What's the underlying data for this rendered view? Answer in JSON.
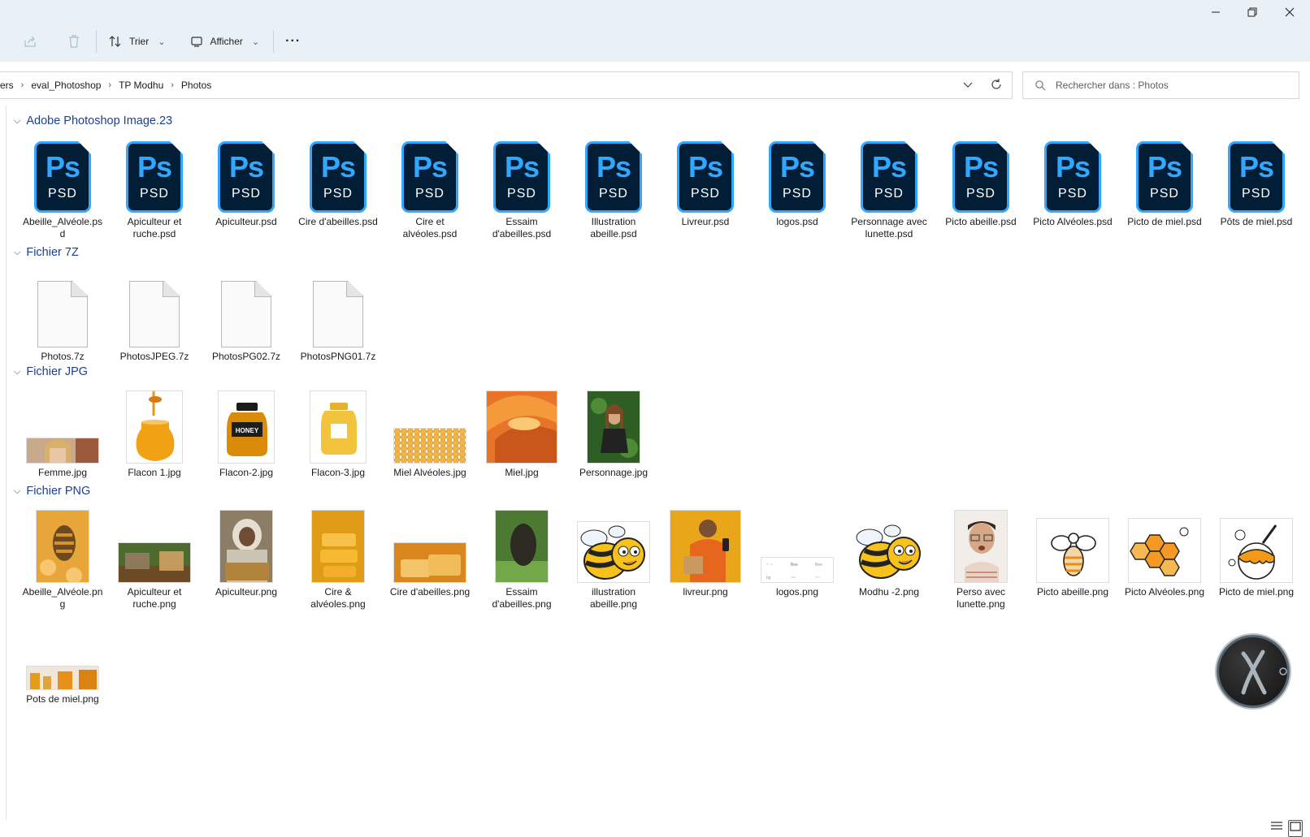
{
  "toolbar": {
    "sort_label": "Trier",
    "view_label": "Afficher",
    "more_label": "···"
  },
  "address": {
    "crumbs": [
      "ers",
      "eval_Photoshop",
      "TP Modhu",
      "Photos"
    ]
  },
  "search": {
    "placeholder": "Rechercher dans : Photos"
  },
  "groups": {
    "psd": {
      "title": "Adobe Photoshop Image.23",
      "icon_main": "Ps",
      "icon_sub": "PSD",
      "items": [
        "Abeille_Alvéole.psd",
        "Apiculteur et ruche.psd",
        "Apiculteur.psd",
        "Cire d'abeilles.psd",
        "Cire et alvéoles.psd",
        "Essaim d'abeilles.psd",
        "Illustration abeille.psd",
        "Livreur.psd",
        "logos.psd",
        "Personnage avec lunette.psd",
        "Picto abeille.psd",
        "Picto Alvéoles.psd",
        "Picto de miel.psd",
        "Pôts de miel.psd"
      ]
    },
    "sevenz": {
      "title": "Fichier 7Z",
      "items": [
        "Photos.7z",
        "PhotosJPEG.7z",
        "PhotosPG02.7z",
        "PhotosPNG01.7z"
      ]
    },
    "jpg": {
      "title": "Fichier JPG",
      "items": [
        "Femme.jpg",
        "Flacon 1.jpg",
        "Flacon-2.jpg",
        "Flacon-3.jpg",
        "Miel Alvéoles.jpg",
        "Miel.jpg",
        "Personnage.jpg"
      ],
      "jar_text": "HONEY"
    },
    "png": {
      "title": "Fichier PNG",
      "items": [
        "Abeille_Alvéole.png",
        "Apiculteur et ruche.png",
        "Apiculteur.png",
        "Cire & alvéoles.png",
        "Cire d'abeilles.png",
        "Essaim d'abeilles.png",
        "illustration abeille.png",
        "livreur.png",
        "logos.png",
        "Modhu -2.png",
        "Perso avec lunette.png",
        "Picto abeille.png",
        "Picto Alvéoles.png",
        "Picto de miel.png",
        "Pots de miel.png"
      ]
    }
  },
  "colors": {
    "accent": "#1b3f97",
    "psd_blue": "#31a8ff",
    "psd_bg": "#011e36",
    "titlebar": "#e9f1f6"
  }
}
